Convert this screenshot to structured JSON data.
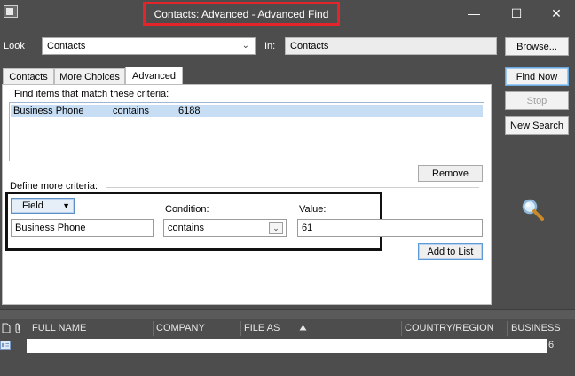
{
  "window": {
    "title": "Contacts: Advanced - Advanced Find",
    "controls": {
      "minimize": "—",
      "maximize": "☐",
      "close": "✕"
    }
  },
  "look": {
    "label": "Look",
    "value": "Contacts"
  },
  "in": {
    "label": "In:",
    "value": "Contacts"
  },
  "buttons": {
    "browse": "Browse...",
    "find_now": "Find Now",
    "stop": "Stop",
    "new_search": "New Search",
    "remove": "Remove",
    "add_to_list": "Add to List"
  },
  "tabs": [
    "Contacts",
    "More Choices",
    "Advanced"
  ],
  "criteria": {
    "heading": "Find items that match these criteria:",
    "rows": [
      {
        "field": "Business Phone",
        "condition": "contains",
        "value": "6188"
      }
    ]
  },
  "define": {
    "heading": "Define more criteria:",
    "field_button": "Field",
    "field_value": "Business Phone",
    "condition_label": "Condition:",
    "condition_value": "contains",
    "value_label": "Value:",
    "value_value": "61"
  },
  "results": {
    "columns": [
      "FULL NAME",
      "COMPANY",
      "FILE AS",
      "COUNTRY/REGION",
      "BUSINESS"
    ],
    "partial_value": "6"
  },
  "colors": {
    "background": "#4d4d4d",
    "title_highlight": "#e3242b",
    "annotation_box": "#111111",
    "selection": "#c6ddf4"
  },
  "icons": [
    "app-icon",
    "minimize-icon",
    "maximize-icon",
    "close-icon",
    "chevron-down-icon",
    "magnifier-icon",
    "attachment-icon",
    "document-icon",
    "contact-card-icon"
  ]
}
